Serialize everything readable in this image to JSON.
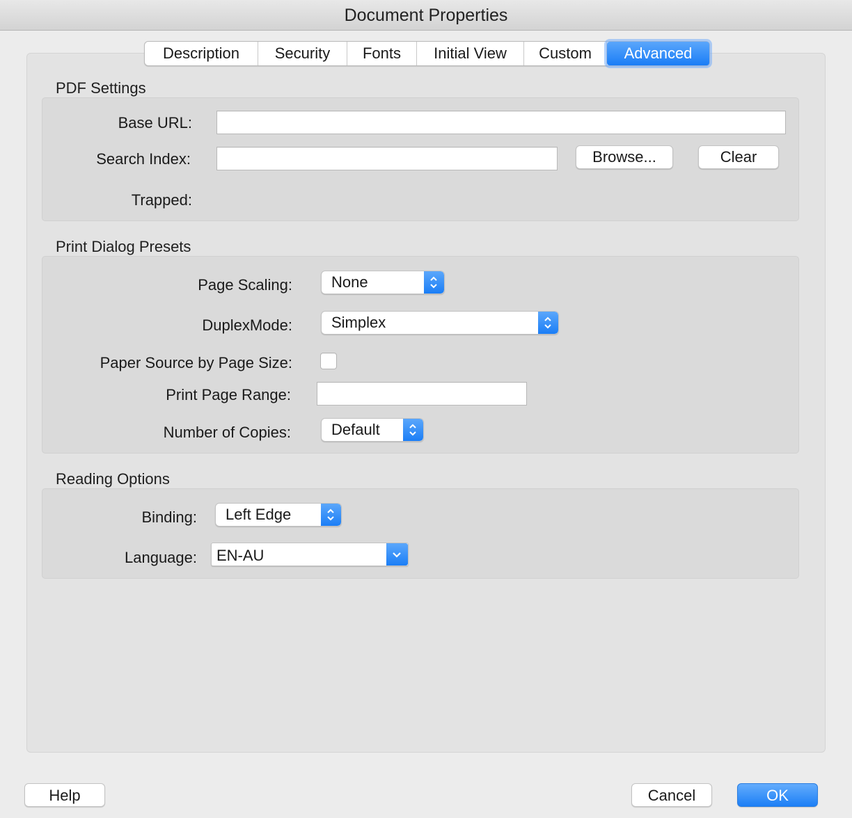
{
  "window": {
    "title": "Document Properties"
  },
  "tabs": [
    {
      "label": "Description"
    },
    {
      "label": "Security"
    },
    {
      "label": "Fonts"
    },
    {
      "label": "Initial View"
    },
    {
      "label": "Custom"
    },
    {
      "label": "Advanced",
      "active": true
    }
  ],
  "pdf_settings": {
    "title": "PDF Settings",
    "base_url_label": "Base URL:",
    "base_url_value": "",
    "search_index_label": "Search Index:",
    "search_index_value": "",
    "browse_label": "Browse...",
    "clear_label": "Clear",
    "trapped_label": "Trapped:"
  },
  "print_presets": {
    "title": "Print Dialog Presets",
    "page_scaling_label": "Page Scaling:",
    "page_scaling_value": "None",
    "duplex_label": "DuplexMode:",
    "duplex_value": "Simplex",
    "paper_source_label": "Paper Source by Page Size:",
    "paper_source_checked": false,
    "page_range_label": "Print Page Range:",
    "page_range_value": "",
    "copies_label": "Number of Copies:",
    "copies_value": "Default"
  },
  "reading_options": {
    "title": "Reading Options",
    "binding_label": "Binding:",
    "binding_value": "Left Edge",
    "language_label": "Language:",
    "language_value": "EN-AU"
  },
  "footer": {
    "help_label": "Help",
    "cancel_label": "Cancel",
    "ok_label": "OK"
  },
  "colors": {
    "accent": "#1a7df6",
    "background": "#ececec",
    "group": "#dadada"
  }
}
